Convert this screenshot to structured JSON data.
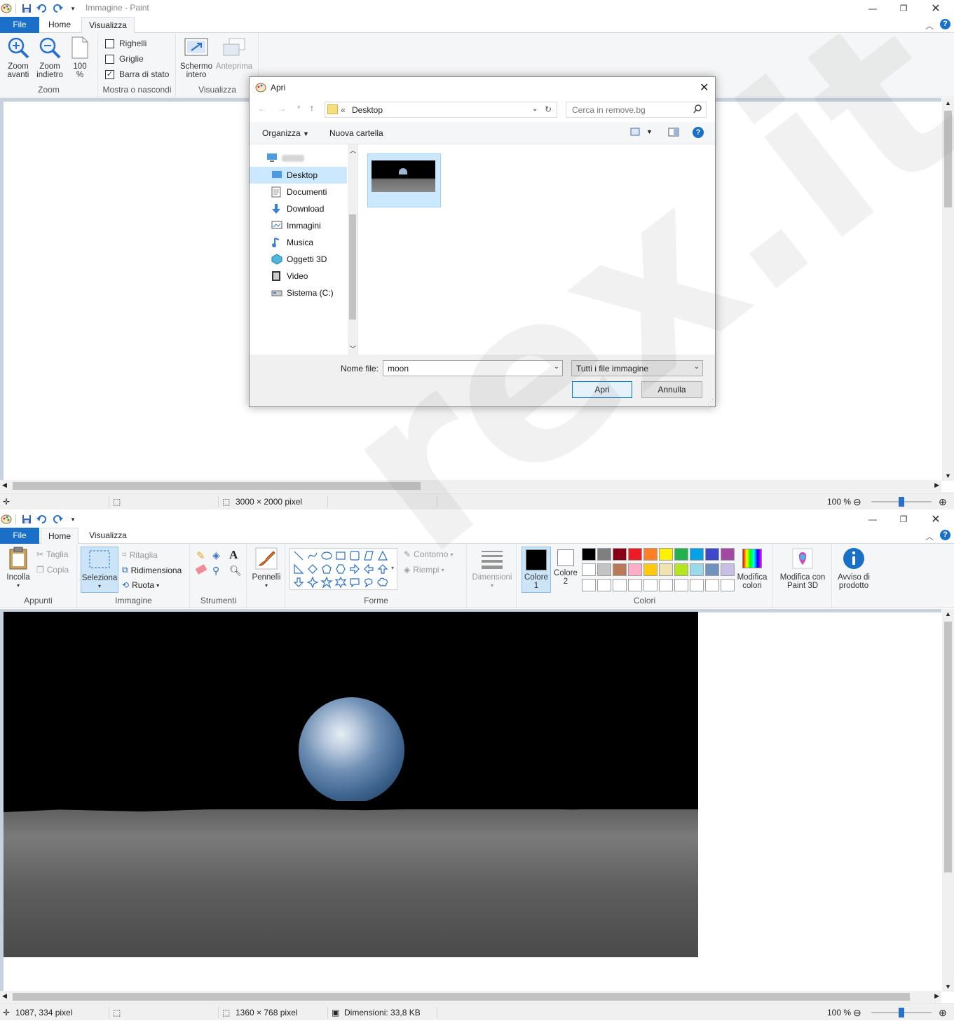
{
  "window1": {
    "title": "Immagine - Paint",
    "tabs": {
      "file": "File",
      "home": "Home",
      "view": "Visualizza"
    },
    "ribbon": {
      "zoom_in_1": "Zoom",
      "zoom_in_2": "avanti",
      "zoom_out_1": "Zoom",
      "zoom_out_2": "indietro",
      "zoom100_1": "100",
      "zoom100_2": "%",
      "zoom_group": "Zoom",
      "rulers": "Righelli",
      "gridlines": "Griglie",
      "statusbar": "Barra di stato",
      "showhide_group": "Mostra o nascondi",
      "fullscreen_1": "Schermo",
      "fullscreen_2": "intero",
      "preview": "Anteprima",
      "view_group": "Visualizza"
    },
    "status": {
      "dimensions": "3000 × 2000 pixel",
      "zoom": "100 %"
    }
  },
  "dialog": {
    "title": "Apri",
    "breadcrumb_prefix": "«",
    "location": "Desktop",
    "search_placeholder": "Cerca in remove.bg",
    "organize": "Organizza",
    "new_folder": "Nuova cartella",
    "sidebar": [
      "Desktop",
      "Documenti",
      "Download",
      "Immagini",
      "Musica",
      "Oggetti 3D",
      "Video",
      "Sistema (C:)"
    ],
    "filename_label": "Nome file:",
    "filename_value": "moon",
    "filetype": "Tutti i file immagine",
    "open": "Apri",
    "cancel": "Annulla"
  },
  "window2": {
    "tabs": {
      "file": "File",
      "home": "Home",
      "view": "Visualizza"
    },
    "ribbon": {
      "paste": "Incolla",
      "cut": "Taglia",
      "copy": "Copia",
      "clipboard_group": "Appunti",
      "select": "Seleziona",
      "crop": "Ritaglia",
      "resize": "Ridimensiona",
      "rotate": "Ruota",
      "image_group": "Immagine",
      "tools_group": "Strumenti",
      "brushes": "Pennelli",
      "outline": "Contorno",
      "fill": "Riempi",
      "shapes_group": "Forme",
      "size": "Dimensioni",
      "color1_1": "Colore",
      "color1_2": "1",
      "color2_1": "Colore",
      "color2_2": "2",
      "edit_colors_1": "Modifica",
      "edit_colors_2": "colori",
      "paint3d_1": "Modifica con",
      "paint3d_2": "Paint 3D",
      "product_1": "Avviso di",
      "product_2": "prodotto",
      "colors_group": "Colori"
    },
    "status": {
      "cursor": "1087, 334 pixel",
      "dimensions": "1360 × 768 pixel",
      "filesize": "Dimensioni: 33,8 KB",
      "zoom": "100 %"
    }
  },
  "palette_row1": [
    "#000000",
    "#7f7f7f",
    "#880015",
    "#ed1c24",
    "#ff7f27",
    "#fff200",
    "#22b14c",
    "#00a2e8",
    "#3f48cc",
    "#a349a4"
  ],
  "palette_row2": [
    "#ffffff",
    "#c3c3c3",
    "#b97a57",
    "#ffaec9",
    "#ffc90e",
    "#efe4b0",
    "#b5e61d",
    "#99d9ea",
    "#7092be",
    "#c8bfe7"
  ],
  "watermark": "rex.it"
}
